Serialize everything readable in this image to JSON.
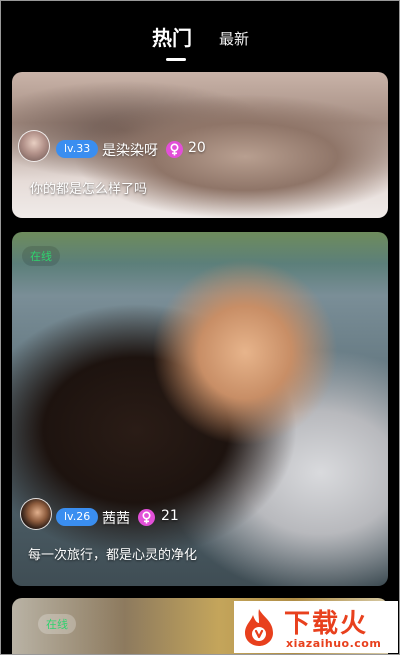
{
  "tabs": {
    "hot": "热门",
    "new": "最新"
  },
  "cards": [
    {
      "level": "lv.33",
      "name": "是染染呀",
      "count": "20",
      "caption": "你的都是怎么样了吗"
    },
    {
      "status": "在线",
      "level": "lv.26",
      "name": "茜茜",
      "count": "21",
      "caption": "每一次旅行，都是心灵的净化"
    },
    {
      "status": "在线"
    }
  ],
  "watermark": {
    "title": "下载火",
    "subtitle": "xiazaihuo.com"
  },
  "colors": {
    "level_badge": "#3a8ef0",
    "gender_badge": "#e24fd8",
    "online": "#2fd36e",
    "watermark": "#e8401d"
  }
}
